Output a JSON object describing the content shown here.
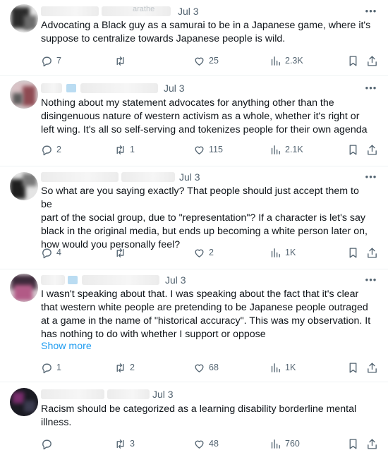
{
  "tweets": [
    {
      "handle_partial": "arathe",
      "date": "Jul 3",
      "text": "Advocating a Black guy as a samurai to be in a Japanese game, where it's\nsuppose to  centralize towards Japanese people is wild.",
      "replies": "7",
      "retweets": "",
      "likes": "25",
      "views": "2.3K"
    },
    {
      "date": "Jul 3",
      "text": "Nothing about my statement advocates for anything other than the\ndisingenuous nature of western activism as a whole, whether it's right or\nleft wing. It's all so self-serving and tokenizes people for their own agenda",
      "replies": "2",
      "retweets": "1",
      "likes": "115",
      "views": "2.1K"
    },
    {
      "date": "Jul 3",
      "text": "So what are you saying exactly? That people should just accept them to be\npart of the social group, due to \"representation\"? If a character is let's say\nblack in the original media, but ends up becoming a white person later on,\nhow would you personally feel?",
      "replies": "4",
      "retweets": "",
      "likes": "2",
      "views": "1K"
    },
    {
      "date": "Jul 3",
      "text": "I wasn't speaking about that. I was speaking about the fact that it's clear\nthat western white people are pretending to be Japanese people outraged\nat a game in the name of \"historical accuracy\". This was my observation. It\nhas nothing to do with whether I support or oppose",
      "show_more": "Show more",
      "replies": "1",
      "retweets": "2",
      "likes": "68",
      "views": "1K"
    },
    {
      "date": "Jul 3",
      "text": "Racism should be categorized as a learning disability borderline mental\nillness.",
      "replies": "",
      "retweets": "3",
      "likes": "48",
      "views": "760"
    }
  ],
  "icons": {
    "reply": "reply-icon",
    "retweet": "retweet-icon",
    "like": "heart-icon",
    "views": "views-icon",
    "bookmark": "bookmark-icon",
    "share": "share-icon",
    "more": "more-icon"
  },
  "colors": {
    "text": "#0f1419",
    "secondary": "#536471",
    "link": "#1d9bf0"
  }
}
